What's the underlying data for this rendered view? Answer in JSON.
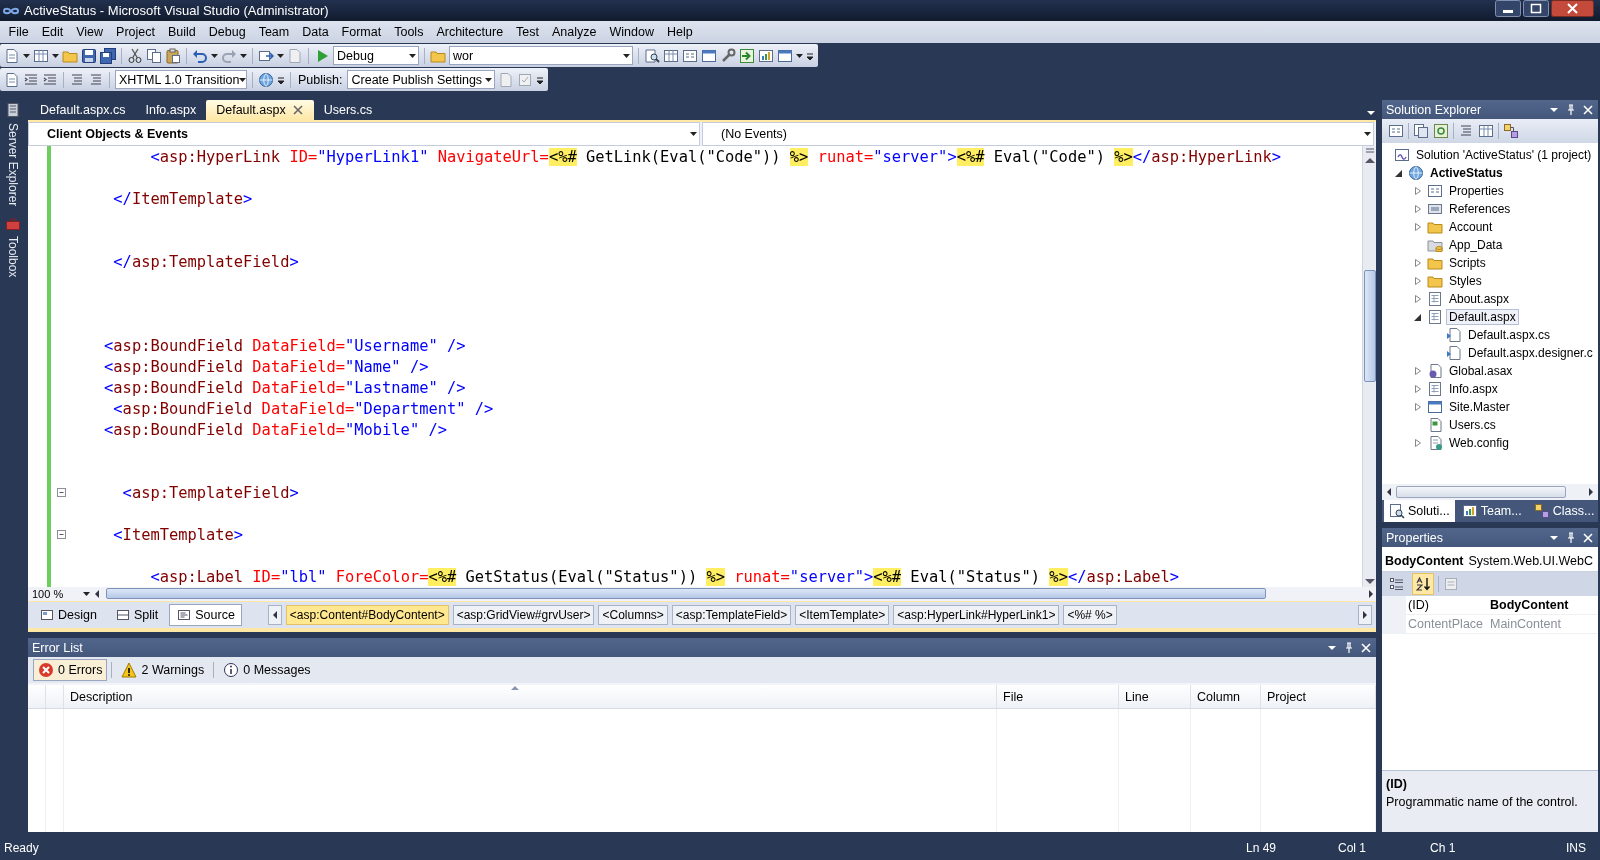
{
  "window": {
    "title": "ActiveStatus - Microsoft Visual Studio (Administrator)"
  },
  "menu": [
    "File",
    "Edit",
    "View",
    "Project",
    "Build",
    "Debug",
    "Team",
    "Data",
    "Format",
    "Tools",
    "Architecture",
    "Test",
    "Analyze",
    "Window",
    "Help"
  ],
  "toolbar_1": {
    "configuration": "Debug",
    "find_field": "wor"
  },
  "toolbar_2": {
    "doctype": "XHTML 1.0 Transition",
    "publish_label": "Publish:",
    "publish_profile": "Create Publish Settings"
  },
  "side_tabs": [
    {
      "label": "Server Explorer",
      "kind": "server"
    },
    {
      "label": "Toolbox",
      "kind": "toolbox"
    }
  ],
  "document_tabs": [
    {
      "label": "Default.aspx.cs",
      "selected": false
    },
    {
      "label": "Info.aspx",
      "selected": false
    },
    {
      "label": "Default.aspx",
      "selected": true
    },
    {
      "label": "Users.cs",
      "selected": false
    }
  ],
  "navigation_bar": {
    "objects": "Client Objects & Events",
    "events": "(No Events)"
  },
  "code_lines": [
    {
      "kind": "code",
      "collapsible": false,
      "tokens": [
        {
          "text": "         <",
          "kind": "punct"
        },
        {
          "text": "asp:HyperLink",
          "kind": "tag"
        },
        {
          "text": " ID=",
          "kind": "attr"
        },
        {
          "text": "\"HyperLink1\"",
          "kind": "value"
        },
        {
          "text": " NavigateUrl=",
          "kind": "attr"
        },
        {
          "text": "<%#",
          "kind": "delimiter"
        },
        {
          "text": " GetLink(Eval(\"Code\")) ",
          "kind": "text"
        },
        {
          "text": "%>",
          "kind": "delimiter"
        },
        {
          "text": " runat=",
          "kind": "attr"
        },
        {
          "text": "\"server\"",
          "kind": "value"
        },
        {
          "text": ">",
          "kind": "punct"
        },
        {
          "text": "<%#",
          "kind": "delimiter"
        },
        {
          "text": " Eval(\"Code\") ",
          "kind": "text"
        },
        {
          "text": "%>",
          "kind": "delimiter"
        },
        {
          "text": "</",
          "kind": "punct"
        },
        {
          "text": "asp:HyperLink",
          "kind": "tag"
        },
        {
          "text": ">",
          "kind": "punct"
        }
      ]
    },
    {
      "kind": "blank"
    },
    {
      "kind": "code",
      "collapsible": false,
      "tokens": [
        {
          "text": "     </",
          "kind": "punct"
        },
        {
          "text": "ItemTemplate",
          "kind": "tag"
        },
        {
          "text": ">",
          "kind": "punct"
        }
      ]
    },
    {
      "kind": "blank"
    },
    {
      "kind": "blank"
    },
    {
      "kind": "code",
      "collapsible": false,
      "tokens": [
        {
          "text": "     </",
          "kind": "punct"
        },
        {
          "text": "asp:TemplateField",
          "kind": "tag"
        },
        {
          "text": ">",
          "kind": "punct"
        }
      ]
    },
    {
      "kind": "blank"
    },
    {
      "kind": "blank"
    },
    {
      "kind": "blank"
    },
    {
      "kind": "code",
      "collapsible": false,
      "tokens": [
        {
          "text": "    <",
          "kind": "punct"
        },
        {
          "text": "asp:BoundField",
          "kind": "tag"
        },
        {
          "text": " DataField=",
          "kind": "attr"
        },
        {
          "text": "\"Username\"",
          "kind": "value"
        },
        {
          "text": " />",
          "kind": "punct"
        }
      ]
    },
    {
      "kind": "code",
      "collapsible": false,
      "tokens": [
        {
          "text": "    <",
          "kind": "punct"
        },
        {
          "text": "asp:BoundField",
          "kind": "tag"
        },
        {
          "text": " DataField=",
          "kind": "attr"
        },
        {
          "text": "\"Name\"",
          "kind": "value"
        },
        {
          "text": " />",
          "kind": "punct"
        }
      ]
    },
    {
      "kind": "code",
      "collapsible": false,
      "tokens": [
        {
          "text": "    <",
          "kind": "punct"
        },
        {
          "text": "asp:BoundField",
          "kind": "tag"
        },
        {
          "text": " DataField=",
          "kind": "attr"
        },
        {
          "text": "\"Lastname\"",
          "kind": "value"
        },
        {
          "text": " />",
          "kind": "punct"
        }
      ]
    },
    {
      "kind": "code",
      "collapsible": false,
      "tokens": [
        {
          "text": "     <",
          "kind": "punct"
        },
        {
          "text": "asp:BoundField",
          "kind": "tag"
        },
        {
          "text": " DataField=",
          "kind": "attr"
        },
        {
          "text": "\"Department\"",
          "kind": "value"
        },
        {
          "text": " />",
          "kind": "punct"
        }
      ]
    },
    {
      "kind": "code",
      "collapsible": false,
      "tokens": [
        {
          "text": "    <",
          "kind": "punct"
        },
        {
          "text": "asp:BoundField",
          "kind": "tag"
        },
        {
          "text": " DataField=",
          "kind": "attr"
        },
        {
          "text": "\"Mobile\"",
          "kind": "value"
        },
        {
          "text": " />",
          "kind": "punct"
        }
      ]
    },
    {
      "kind": "blank"
    },
    {
      "kind": "blank"
    },
    {
      "kind": "code",
      "collapsible": true,
      "tokens": [
        {
          "text": "      <",
          "kind": "punct"
        },
        {
          "text": "asp:TemplateField",
          "kind": "tag"
        },
        {
          "text": ">",
          "kind": "punct"
        }
      ]
    },
    {
      "kind": "blank"
    },
    {
      "kind": "code",
      "collapsible": true,
      "tokens": [
        {
          "text": "     <",
          "kind": "punct"
        },
        {
          "text": "ItemTemplate",
          "kind": "tag"
        },
        {
          "text": ">",
          "kind": "punct"
        }
      ]
    },
    {
      "kind": "blank"
    },
    {
      "kind": "code",
      "collapsible": false,
      "tokens": [
        {
          "text": "         <",
          "kind": "punct"
        },
        {
          "text": "asp:Label",
          "kind": "tag"
        },
        {
          "text": " ID=",
          "kind": "attr"
        },
        {
          "text": "\"lbl\"",
          "kind": "value"
        },
        {
          "text": " ForeColor=",
          "kind": "attr"
        },
        {
          "text": "<%#",
          "kind": "delimiter"
        },
        {
          "text": " GetStatus(Eval(\"Status\")) ",
          "kind": "text"
        },
        {
          "text": "%>",
          "kind": "delimiter"
        },
        {
          "text": " runat=",
          "kind": "attr"
        },
        {
          "text": "\"server\"",
          "kind": "value"
        },
        {
          "text": ">",
          "kind": "punct"
        },
        {
          "text": "<%#",
          "kind": "delimiter"
        },
        {
          "text": " Eval(\"Status\") ",
          "kind": "text"
        },
        {
          "text": "%>",
          "kind": "delimiter"
        },
        {
          "text": "</",
          "kind": "punct"
        },
        {
          "text": "asp:Label",
          "kind": "tag"
        },
        {
          "text": ">",
          "kind": "punct"
        }
      ]
    }
  ],
  "zoom": "100 %",
  "view_tabs": [
    {
      "label": "Design",
      "kind": "design",
      "selected": false
    },
    {
      "label": "Split",
      "kind": "split",
      "selected": false
    },
    {
      "label": "Source",
      "kind": "source",
      "selected": true
    }
  ],
  "breadcrumbs": [
    {
      "label": "<asp:Content#BodyContent>",
      "selected": true
    },
    {
      "label": "<asp:GridView#grvUser>",
      "selected": false
    },
    {
      "label": "<Columns>",
      "selected": false
    },
    {
      "label": "<asp:TemplateField>",
      "selected": false
    },
    {
      "label": "<ItemTemplate>",
      "selected": false
    },
    {
      "label": "<asp:HyperLink#HyperLink1>",
      "selected": false
    },
    {
      "label": "<%# %>",
      "selected": false
    }
  ],
  "error_list": {
    "title": "Error List",
    "filters": [
      {
        "kind": "error",
        "label": "0 Errors",
        "selected": true
      },
      {
        "kind": "warning",
        "label": "2 Warnings",
        "selected": false
      },
      {
        "kind": "info",
        "label": "0 Messages",
        "selected": false
      }
    ],
    "columns": [
      "Description",
      "File",
      "Line",
      "Column",
      "Project"
    ]
  },
  "solution_explorer": {
    "title": "Solution Explorer",
    "tree": [
      {
        "label": "Solution 'ActiveStatus' (1 project)",
        "kind": "solution",
        "expandable": false,
        "selected": false,
        "children": [
          {
            "label": "ActiveStatus",
            "kind": "project",
            "expandable": true,
            "expanded": true,
            "selected": false,
            "children": [
              {
                "label": "Properties",
                "kind": "properties",
                "expandable": true,
                "expanded": false,
                "selected": false
              },
              {
                "label": "References",
                "kind": "references",
                "expandable": true,
                "expanded": false,
                "selected": false
              },
              {
                "label": "Account",
                "kind": "folder",
                "expandable": true,
                "expanded": false,
                "selected": false
              },
              {
                "label": "App_Data",
                "kind": "data-folder",
                "expandable": false,
                "selected": false
              },
              {
                "label": "Scripts",
                "kind": "folder",
                "expandable": true,
                "expanded": false,
                "selected": false
              },
              {
                "label": "Styles",
                "kind": "folder",
                "expandable": true,
                "expanded": false,
                "selected": false
              },
              {
                "label": "About.aspx",
                "kind": "page",
                "expandable": true,
                "expanded": false,
                "selected": false
              },
              {
                "label": "Default.aspx",
                "kind": "page",
                "expandable": true,
                "expanded": true,
                "selected": true,
                "children": [
                  {
                    "label": "Default.aspx.cs",
                    "kind": "code-behind",
                    "expandable": false,
                    "selected": false
                  },
                  {
                    "label": "Default.aspx.designer.c",
                    "kind": "code-behind",
                    "expandable": false,
                    "selected": false
                  }
                ]
              },
              {
                "label": "Global.asax",
                "kind": "global",
                "expandable": true,
                "expanded": false,
                "selected": false
              },
              {
                "label": "Info.aspx",
                "kind": "page",
                "expandable": true,
                "expanded": false,
                "selected": false
              },
              {
                "label": "Site.Master",
                "kind": "master",
                "expandable": true,
                "expanded": false,
                "selected": false
              },
              {
                "label": "Users.cs",
                "kind": "csharp",
                "expandable": false,
                "selected": false
              },
              {
                "label": "Web.config",
                "kind": "config",
                "expandable": true,
                "expanded": false,
                "selected": false
              }
            ]
          }
        ]
      }
    ],
    "tabs": [
      {
        "label": "Soluti...",
        "kind": "solution",
        "selected": true
      },
      {
        "label": "Team...",
        "kind": "team",
        "selected": false
      },
      {
        "label": "Class...",
        "kind": "class",
        "selected": false
      }
    ]
  },
  "properties": {
    "title": "Properties",
    "object_name": "BodyContent",
    "object_type": "System.Web.UI.WebC",
    "sort_buttons": [
      {
        "kind": "categorized",
        "selected": false
      },
      {
        "kind": "alphabetical",
        "selected": true
      }
    ],
    "rows": [
      {
        "name": "(ID)",
        "value": "BodyContent",
        "read_only": false,
        "modified": true
      },
      {
        "name": "ContentPlace",
        "value": "MainContent",
        "read_only": true,
        "modified": false
      }
    ],
    "description": {
      "title": "(ID)",
      "text": "Programmatic name of the control."
    }
  },
  "status_bar": {
    "message": "Ready",
    "line": "Ln 49",
    "column": "Col 1",
    "char": "Ch 1",
    "mode": "INS"
  }
}
